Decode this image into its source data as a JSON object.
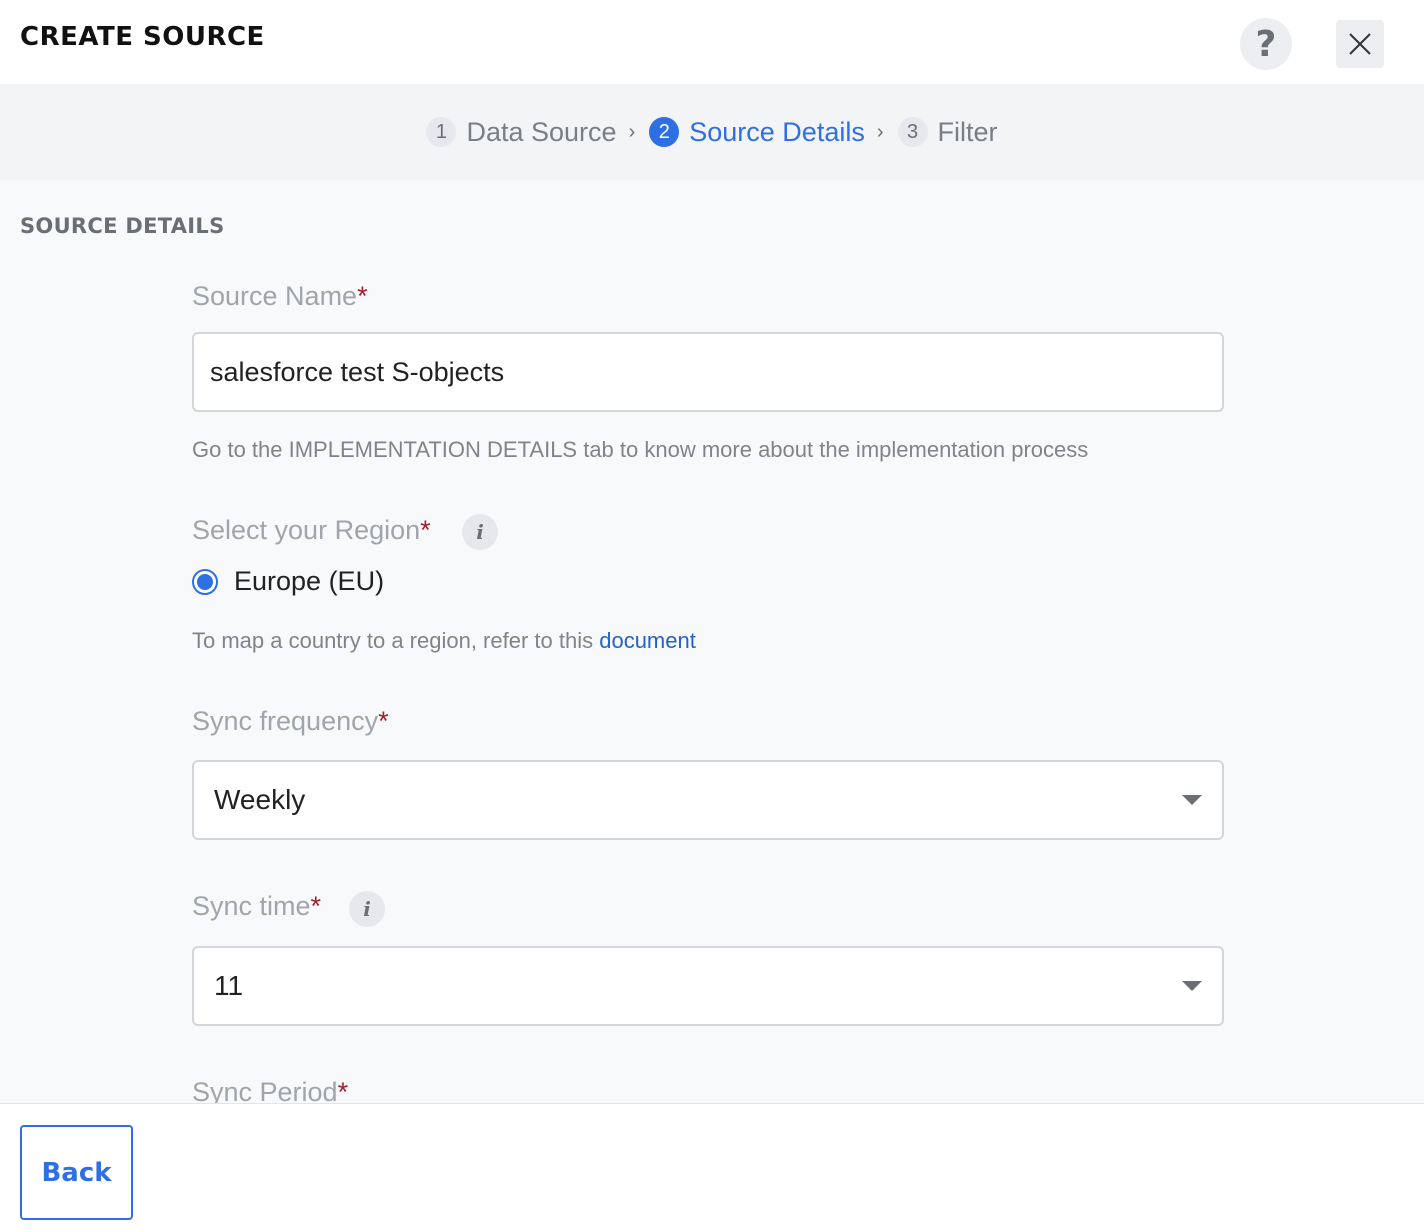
{
  "header": {
    "title": "CREATE SOURCE",
    "help_symbol": "?",
    "close_icon": "close-icon"
  },
  "stepper": {
    "steps": [
      {
        "num": "1",
        "label": "Data Source",
        "active": false
      },
      {
        "num": "2",
        "label": "Source Details",
        "active": true
      },
      {
        "num": "3",
        "label": "Filter",
        "active": false
      }
    ],
    "separator": "›"
  },
  "section": {
    "title": "SOURCE DETAILS"
  },
  "form": {
    "source_name": {
      "label": "Source Name",
      "required_mark": "*",
      "value": "salesforce test S-objects",
      "hint": "Go to the IMPLEMENTATION DETAILS tab to know more about the implementation process"
    },
    "region": {
      "label": "Select your Region",
      "required_mark": "*",
      "info_symbol": "i",
      "option": "Europe (EU)",
      "selected": true,
      "hint_prefix": "To map a country to a region, refer to this",
      "hint_link": "document"
    },
    "sync_frequency": {
      "label": "Sync frequency",
      "required_mark": "*",
      "value": "Weekly"
    },
    "sync_time": {
      "label": "Sync time",
      "required_mark": "*",
      "info_symbol": "i",
      "value": "11"
    },
    "sync_period": {
      "label": "Sync Period",
      "required_mark": "*"
    }
  },
  "footer": {
    "back_label": "Back"
  },
  "colors": {
    "accent": "#2f6fe4",
    "required": "#a3202b",
    "link": "#2463c4"
  }
}
